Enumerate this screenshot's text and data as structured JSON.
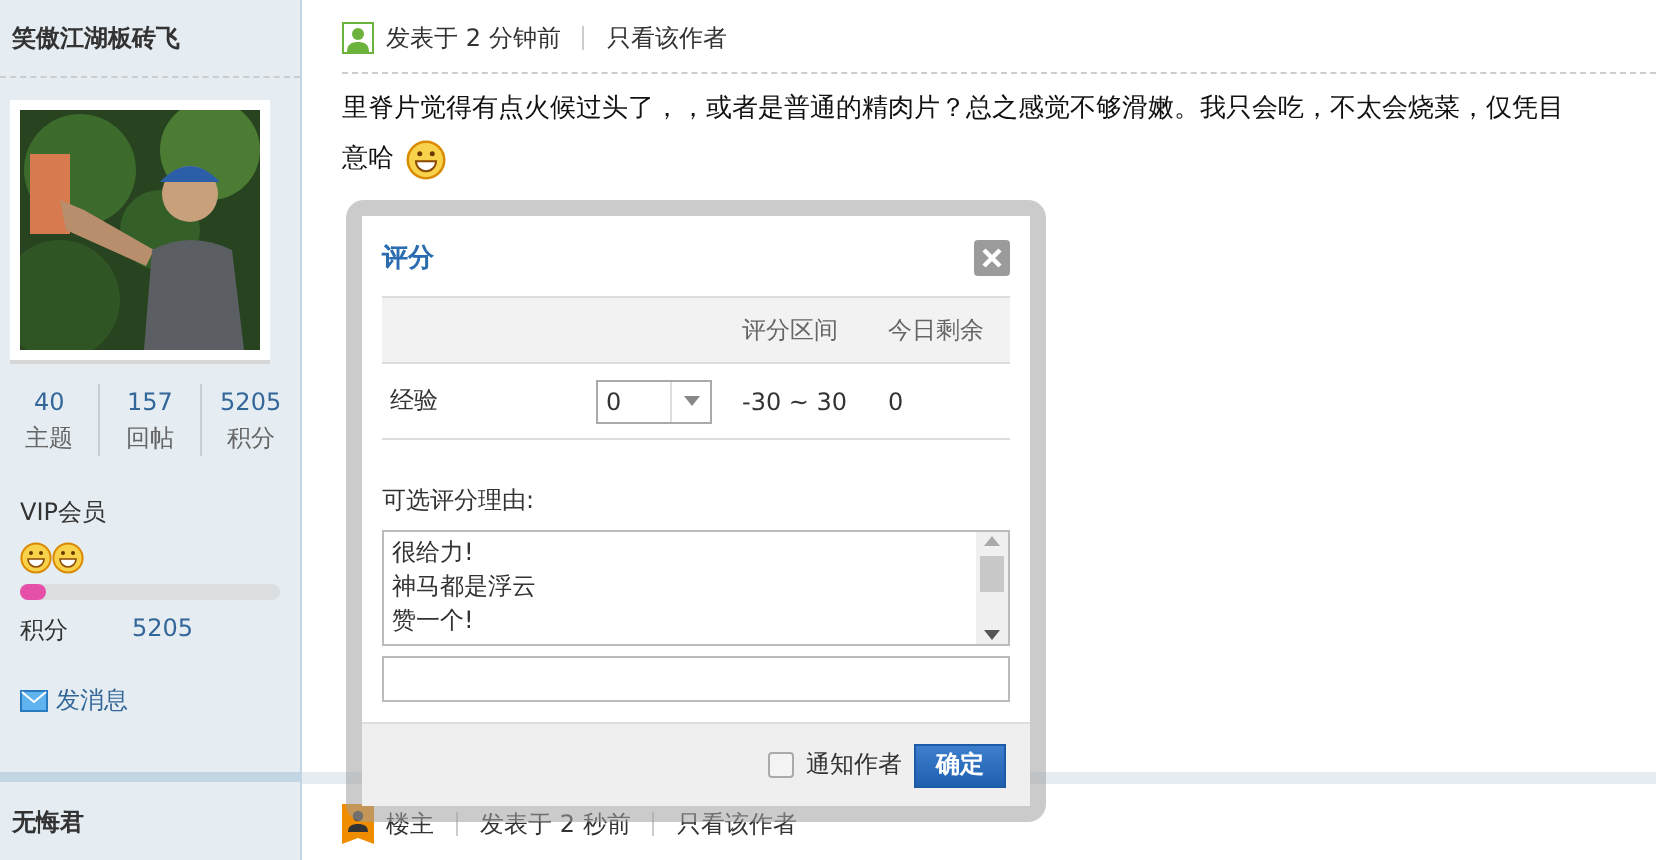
{
  "sidebar": {
    "users": [
      {
        "name": "笑傲江湖板砖飞",
        "avatar": {
          "kind": "picture"
        },
        "stats": [
          {
            "value": "40",
            "label": "主题"
          },
          {
            "value": "157",
            "label": "回帖"
          },
          {
            "value": "5205",
            "label": "积分"
          }
        ],
        "group": "VIP会员",
        "rank_icons": [
          {
            "kind": "smiley"
          },
          {
            "kind": "smiley"
          }
        ],
        "level": 0.1,
        "points_label": "积分",
        "points": "5205",
        "message_link": "发消息"
      },
      {
        "name": "无悔君"
      }
    ]
  },
  "posts": [
    {
      "kind": "member",
      "meta": [
        "发表于 2 分钟前",
        "只看该作者"
      ],
      "lines": [
        "里脊片觉得有点火候过头了，，或者是普通的精肉片？总之感觉不够滑嫩。我只会吃，不太会烧菜，仅凭目",
        "意哈"
      ]
    },
    {
      "kind": "owner",
      "role": "楼主",
      "meta": [
        "发表于 2 秒前",
        "只看该作者"
      ]
    }
  ],
  "dialog": {
    "title": "评分",
    "columns": [
      "评分区间",
      "今日剩余"
    ],
    "rows": [
      {
        "label": "经验",
        "value": "0",
        "range": "-30 ~ 30",
        "remaining": "0"
      }
    ],
    "reasons_label": "可选评分理由:",
    "reasons": [
      "很给力!",
      "神马都是浮云",
      "赞一个!"
    ],
    "notify": {
      "label": "通知作者",
      "checked": false
    },
    "submit": "确定"
  }
}
